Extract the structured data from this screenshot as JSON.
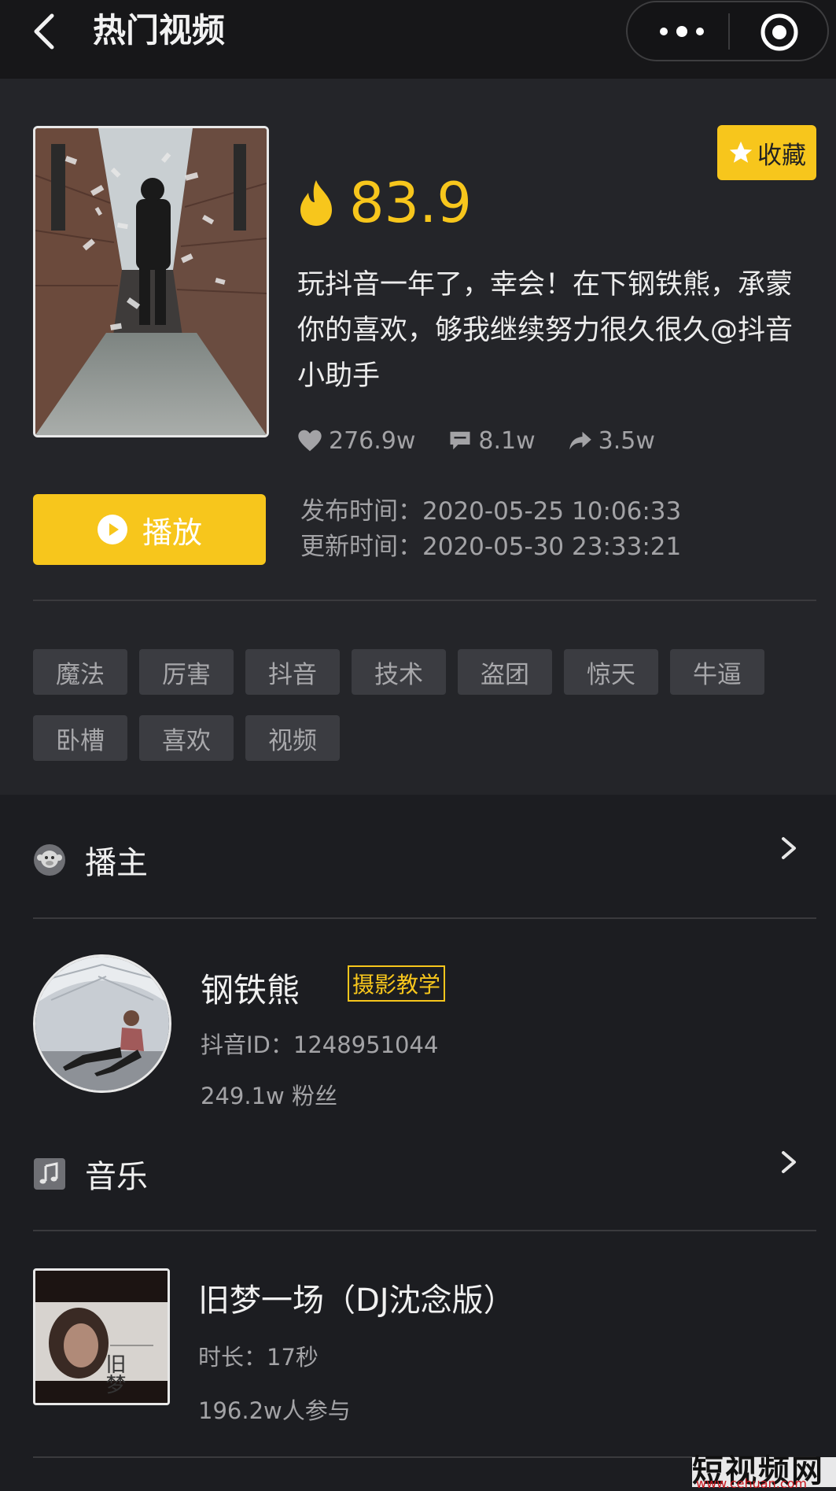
{
  "header": {
    "title": "热门视频",
    "back_icon": "chevron-left-icon",
    "more_icon": "more-dots-icon",
    "close_icon": "target-circle-icon"
  },
  "video": {
    "collect_label": "收藏",
    "heat_value": "83.9",
    "description": "玩抖音一年了，幸会！在下钢铁熊，承蒙你的喜欢，够我继续努力很久很久@抖音小助手",
    "likes": "276.9w",
    "comments": "8.1w",
    "shares": "3.5w",
    "play_label": "播放",
    "publish_time": "发布时间：2020-05-25 10:06:33",
    "update_time": "更新时间：2020-05-30 23:33:21",
    "tags": [
      "魔法",
      "厉害",
      "抖音",
      "技术",
      "盗团",
      "惊天",
      "牛逼",
      "卧槽",
      "喜欢",
      "视频"
    ]
  },
  "author_section": {
    "title": "播主",
    "name": "钢铁熊",
    "badge": "摄影教学",
    "douyin_id": "抖音ID：1248951044",
    "fans": "249.1w 粉丝"
  },
  "music_section": {
    "title": "音乐",
    "name": "旧梦一场（DJ沈念版）",
    "duration": "时长：17秒",
    "participants": "196.2w人参与",
    "cover_text": "旧梦一场"
  },
  "watermark": {
    "text": "短视频网",
    "url": "www.cehuan.com"
  },
  "colors": {
    "accent": "#f7c61c",
    "background": "#1c1d21",
    "card": "#242529",
    "muted_text": "#a3a3a6"
  }
}
